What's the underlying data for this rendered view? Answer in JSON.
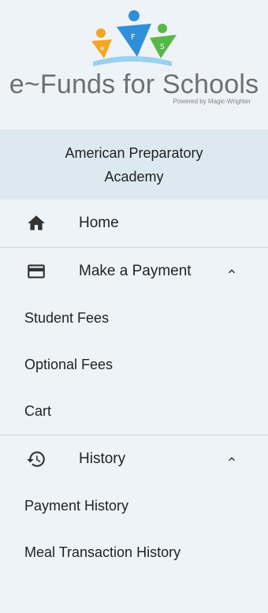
{
  "logo": {
    "title": "e~Funds for Schools",
    "tagline": "Powered by Magic-Wrighter",
    "figure_letters": [
      "e",
      "F",
      "S"
    ],
    "colors": {
      "orange": "#f2a623",
      "blue": "#2f8fd8",
      "green": "#58b847"
    }
  },
  "school": {
    "name": "American Preparatory Academy"
  },
  "nav": {
    "home": {
      "label": "Home",
      "icon": "home-icon"
    },
    "payment": {
      "label": "Make a Payment",
      "icon": "credit-card-icon",
      "expanded": true,
      "items": [
        "Student Fees",
        "Optional Fees",
        "Cart"
      ]
    },
    "history": {
      "label": "History",
      "icon": "history-icon",
      "expanded": true,
      "items": [
        "Payment History",
        "Meal Transaction History"
      ]
    }
  }
}
